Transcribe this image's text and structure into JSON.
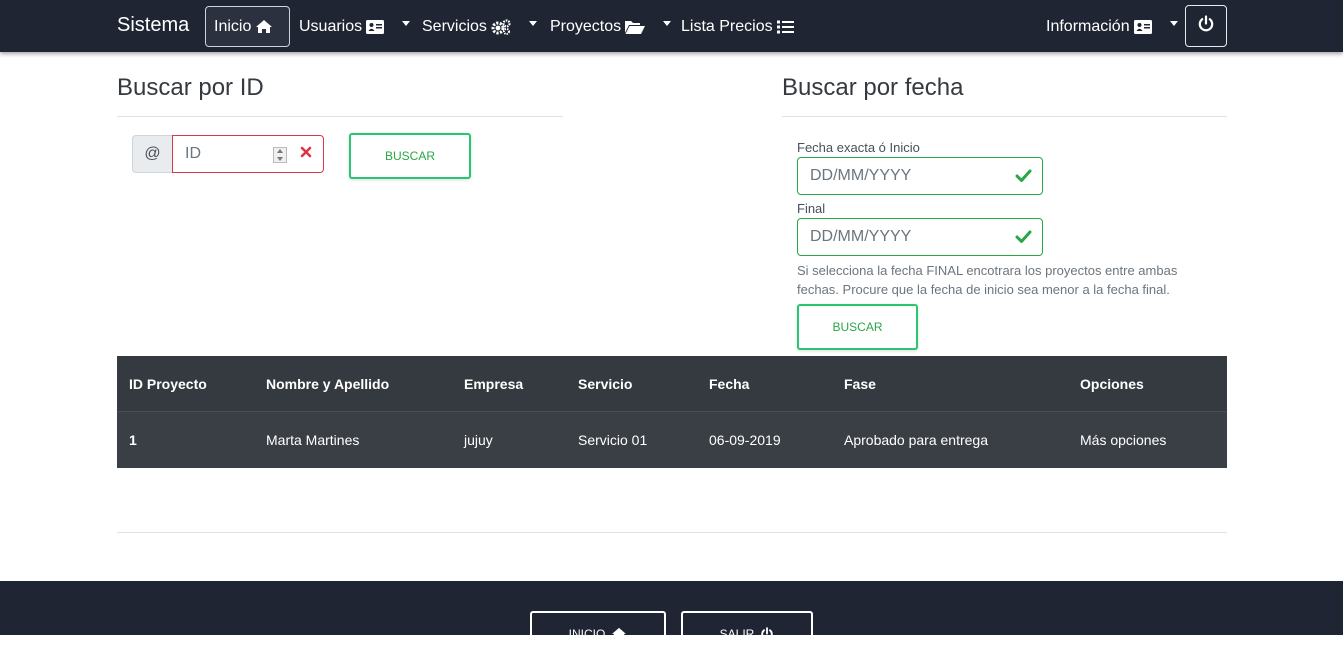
{
  "navbar": {
    "brand": "Sistema",
    "items": [
      {
        "label": "Inicio",
        "icon": "home-icon",
        "active": true
      },
      {
        "label": "Usuarios",
        "icon": "id-card-icon",
        "dropdown": true
      },
      {
        "label": "Servicios",
        "icon": "cogs-icon",
        "dropdown": true
      },
      {
        "label": "Proyectos",
        "icon": "folder-open-icon",
        "dropdown": true
      },
      {
        "label": "Lista Precios",
        "icon": "list-icon"
      }
    ],
    "right": {
      "label": "Información",
      "icon": "id-card-icon",
      "dropdown": true
    },
    "power_icon": "power-icon"
  },
  "search_id": {
    "title": "Buscar por ID",
    "addon": "@",
    "placeholder": "ID",
    "button": "BUSCAR"
  },
  "search_date": {
    "title": "Buscar por fecha",
    "start_label": "Fecha exacta ó Inicio",
    "start_placeholder": "DD/MM/YYYY",
    "end_label": "Final",
    "end_placeholder": "DD/MM/YYYY",
    "help": "Si selecciona la fecha FINAL encotrara los proyectos entre ambas fechas. Procure que la fecha de inicio sea menor a la fecha final.",
    "button": "BUSCAR"
  },
  "table": {
    "headers": [
      "ID Proyecto",
      "Nombre y Apellido",
      "Empresa",
      "Servicio",
      "Fecha",
      "Fase",
      "Opciones"
    ],
    "rows": [
      [
        "1",
        "Marta Martines",
        "jujuy",
        "Servicio 01",
        "06-09-2019",
        "Aprobado para entrega",
        "Más opciones"
      ]
    ]
  },
  "footer": {
    "inicio": "INICIO",
    "salir": "SALIR"
  },
  "colors": {
    "navbar": "#1f2533",
    "success": "#28a745",
    "danger": "#dc3545",
    "table_head": "#343a40"
  }
}
